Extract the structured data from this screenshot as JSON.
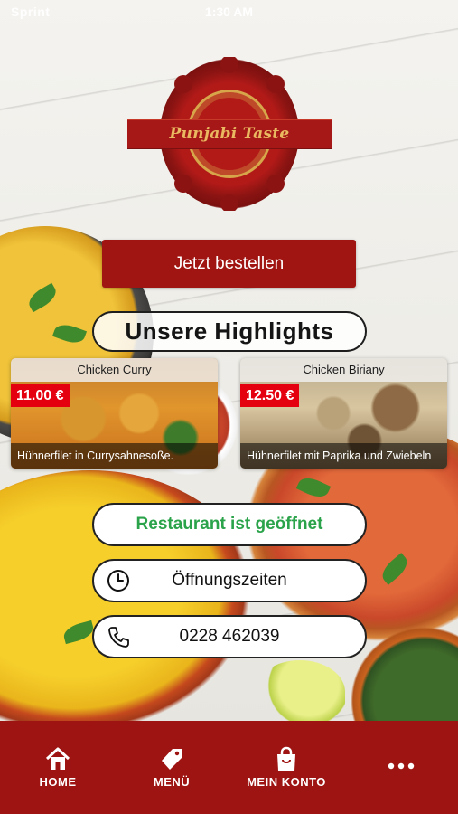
{
  "status_bar": {
    "carrier": "Sprint",
    "time": "1:30 AM"
  },
  "brand": {
    "name": "Punjabi Taste"
  },
  "order_button": {
    "label": "Jetzt bestellen"
  },
  "highlights": {
    "title": "Unsere Highlights",
    "dishes": [
      {
        "name": "Chicken Curry",
        "price": "11.00 €",
        "description": "Hühnerfilet in Currysahnesoße."
      },
      {
        "name": "Chicken Biriany",
        "price": "12.50 €",
        "description": "Hühnerfilet mit Paprika und Zwiebeln"
      }
    ]
  },
  "info": {
    "status": "Restaurant ist geöffnet",
    "hours_label": "Öffnungszeiten",
    "phone": "0228 462039"
  },
  "bottom_nav": {
    "items": [
      {
        "label": "HOME",
        "icon": "home-icon"
      },
      {
        "label": "MENÜ",
        "icon": "tag-icon"
      },
      {
        "label": "MEIN KONTO",
        "icon": "shopping-bag-icon"
      },
      {
        "label": "",
        "icon": "more-dots-icon"
      }
    ]
  },
  "colors": {
    "brand_red": "#9d1412",
    "price_red": "#e4000f",
    "open_green": "#2aa34a",
    "logo_gold": "#e9b860"
  }
}
